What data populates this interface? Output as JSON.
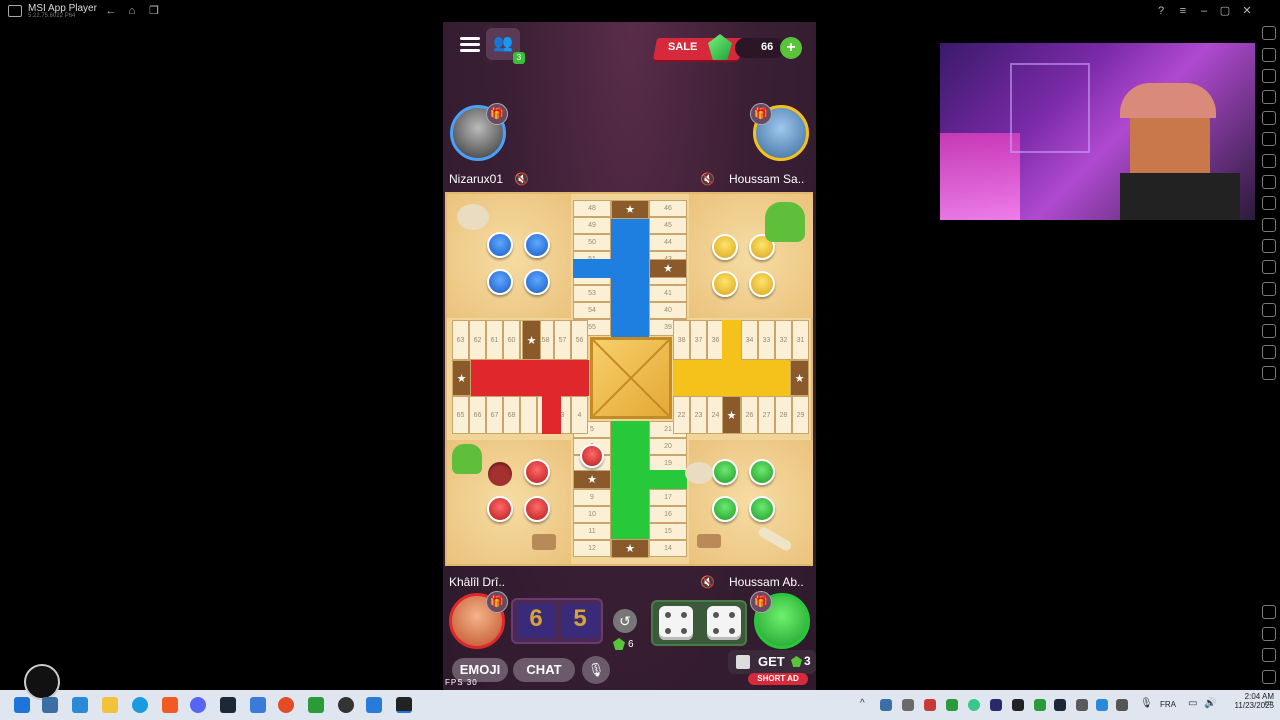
{
  "app": {
    "title": "MSI App Player",
    "version": "5.22.75.6022 P64"
  },
  "game": {
    "sale_label": "SALE",
    "gem_count": "66",
    "friends_badge": "3",
    "players": {
      "top_left": {
        "name": "Nizarux01",
        "color": "blue"
      },
      "top_right": {
        "name": "Houssam Sa..",
        "color": "yellow"
      },
      "bottom_left": {
        "name": "Khâlîl Drî..",
        "color": "red"
      },
      "bottom_right": {
        "name": "Houssam Ab..",
        "color": "green"
      }
    },
    "board": {
      "top_left_col": [
        "48",
        "49",
        "50",
        "51",
        "",
        "53",
        "54",
        "55"
      ],
      "top_right_col": [
        "46",
        "45",
        "44",
        "43",
        "",
        "41",
        "40",
        "39"
      ],
      "left_top_row": [
        "63",
        "62",
        "61",
        "60",
        "",
        "58",
        "57",
        "56"
      ],
      "left_bottom_row": [
        "65",
        "66",
        "67",
        "68",
        "",
        "2",
        "3",
        "4"
      ],
      "right_top_row": [
        "38",
        "37",
        "36",
        "",
        "34",
        "33",
        "32",
        "31"
      ],
      "right_bottom_row": [
        "22",
        "23",
        "24",
        "",
        "26",
        "27",
        "28",
        "29"
      ],
      "bottom_left_col": [
        "5",
        "6",
        "7",
        "",
        "9",
        "10",
        "11",
        "12"
      ],
      "bottom_right_col": [
        "21",
        "20",
        "19",
        "",
        "17",
        "16",
        "15",
        "14"
      ]
    },
    "dice": {
      "value_1": "6",
      "value_2": "5"
    },
    "undo_cost": "6",
    "emoji_label": "EMOJI",
    "chat_label": "CHAT",
    "get_label": "GET",
    "get_count": "3",
    "short_ad_label": "SHORT AD",
    "fps_label": "FPS",
    "fps_value": "30"
  },
  "taskbar": {
    "language": "FRA",
    "time": "2:04 AM",
    "date": "11/23/2025"
  },
  "colors": {
    "blue": "#1a5bc4",
    "red": "#e0282c",
    "yellow": "#f4c21a",
    "green": "#27c83a",
    "board": "#f1d498"
  }
}
